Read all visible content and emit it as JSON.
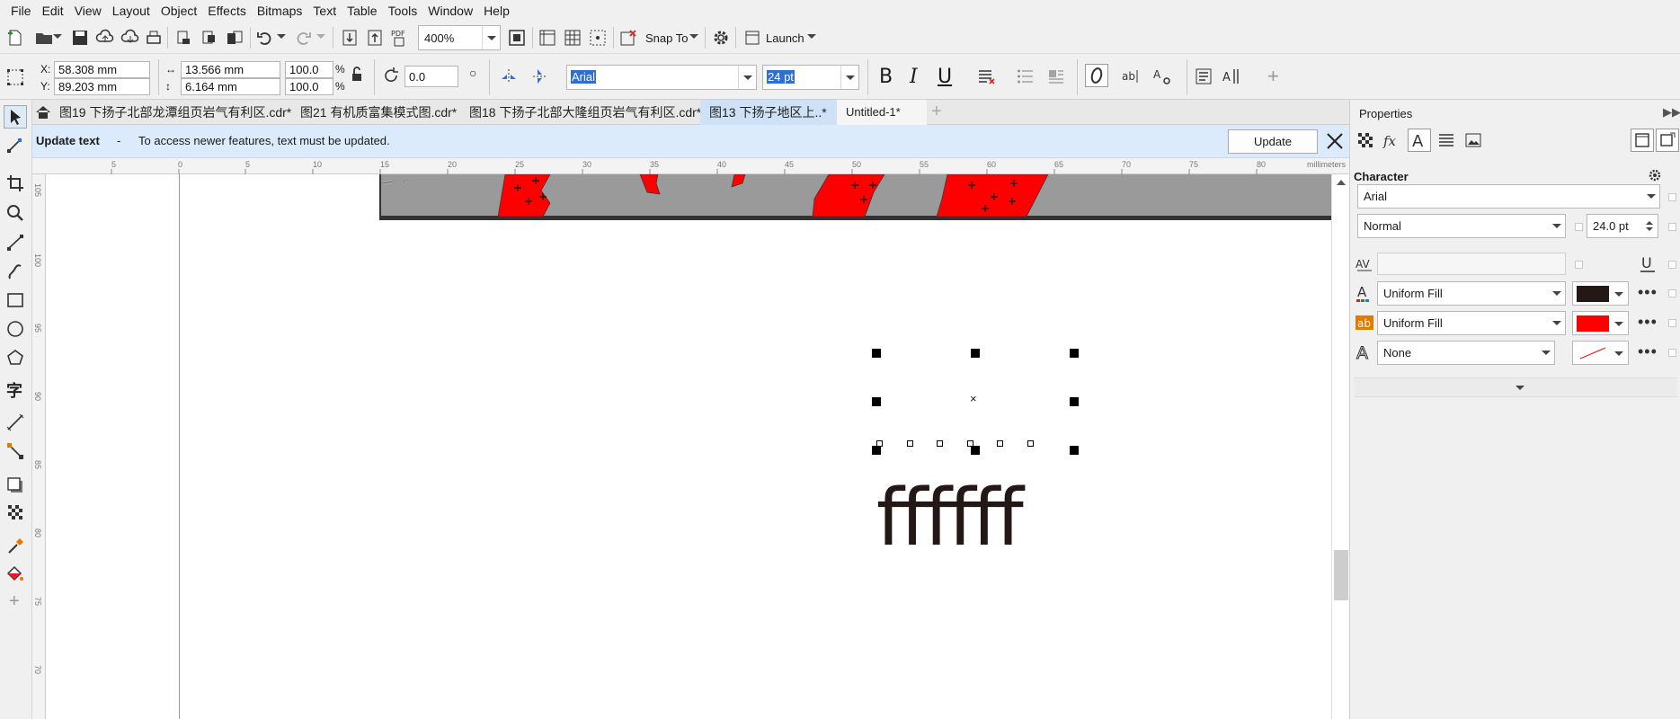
{
  "menu": [
    "File",
    "Edit",
    "View",
    "Layout",
    "Object",
    "Effects",
    "Bitmaps",
    "Text",
    "Table",
    "Tools",
    "Window",
    "Help"
  ],
  "toolbar": {
    "zoom": "400%",
    "snap_label": "Snap To",
    "launch_label": "Launch"
  },
  "propbar": {
    "x_label": "X:",
    "y_label": "Y:",
    "x_value": "58.308 mm",
    "y_value": "89.203 mm",
    "width_value": "13.566 mm",
    "height_value": "6.164 mm",
    "scale_x": "100.0",
    "scale_y": "100.0",
    "pct": "%",
    "rotation": "0.0",
    "font": "Arial",
    "font_size": "24 pt",
    "bold_glyph": "B",
    "italic_glyph": "I",
    "underline_glyph": "U"
  },
  "tabs": [
    {
      "label": "图19 下扬子北部龙潭组页岩气有利区.cdr*",
      "active": false
    },
    {
      "label": "图21 有机质富集模式图.cdr*",
      "active": false
    },
    {
      "label": "图18 下扬子北部大隆组页岩气有利区.cdr*",
      "active": false
    },
    {
      "label": "图13  下扬子地区上..*",
      "active": true
    },
    {
      "label": "Untitled-1*",
      "active": false
    }
  ],
  "notification": {
    "title": "Update text",
    "dash": "-",
    "message": "To access newer features, text must be updated.",
    "button": "Update"
  },
  "ruler": {
    "unit": "millimeters",
    "h_ticks": [
      "5",
      "0",
      "5",
      "10",
      "15",
      "20",
      "25",
      "30",
      "35",
      "40",
      "45",
      "50",
      "55",
      "60",
      "65",
      "70",
      "75",
      "80"
    ],
    "v_ticks": [
      "105",
      "100",
      "95",
      "90",
      "85",
      "80",
      "75",
      "70"
    ]
  },
  "canvas": {
    "text_object": "ffffff"
  },
  "properties": {
    "title": "Properties",
    "section": "Character",
    "font": "Arial",
    "style": "Normal",
    "size": "24.0 pt",
    "text_fill_type": "Uniform Fill",
    "text_fill_color": "#231815",
    "bg_fill_type": "Uniform Fill",
    "bg_fill_color": "#ff0000",
    "outline_type": "None"
  },
  "colors": {
    "accent": "#2f6fd1",
    "notif_bg": "#dcebfb",
    "map_red": "#ff0000",
    "map_gray": "#9a9a9a"
  }
}
